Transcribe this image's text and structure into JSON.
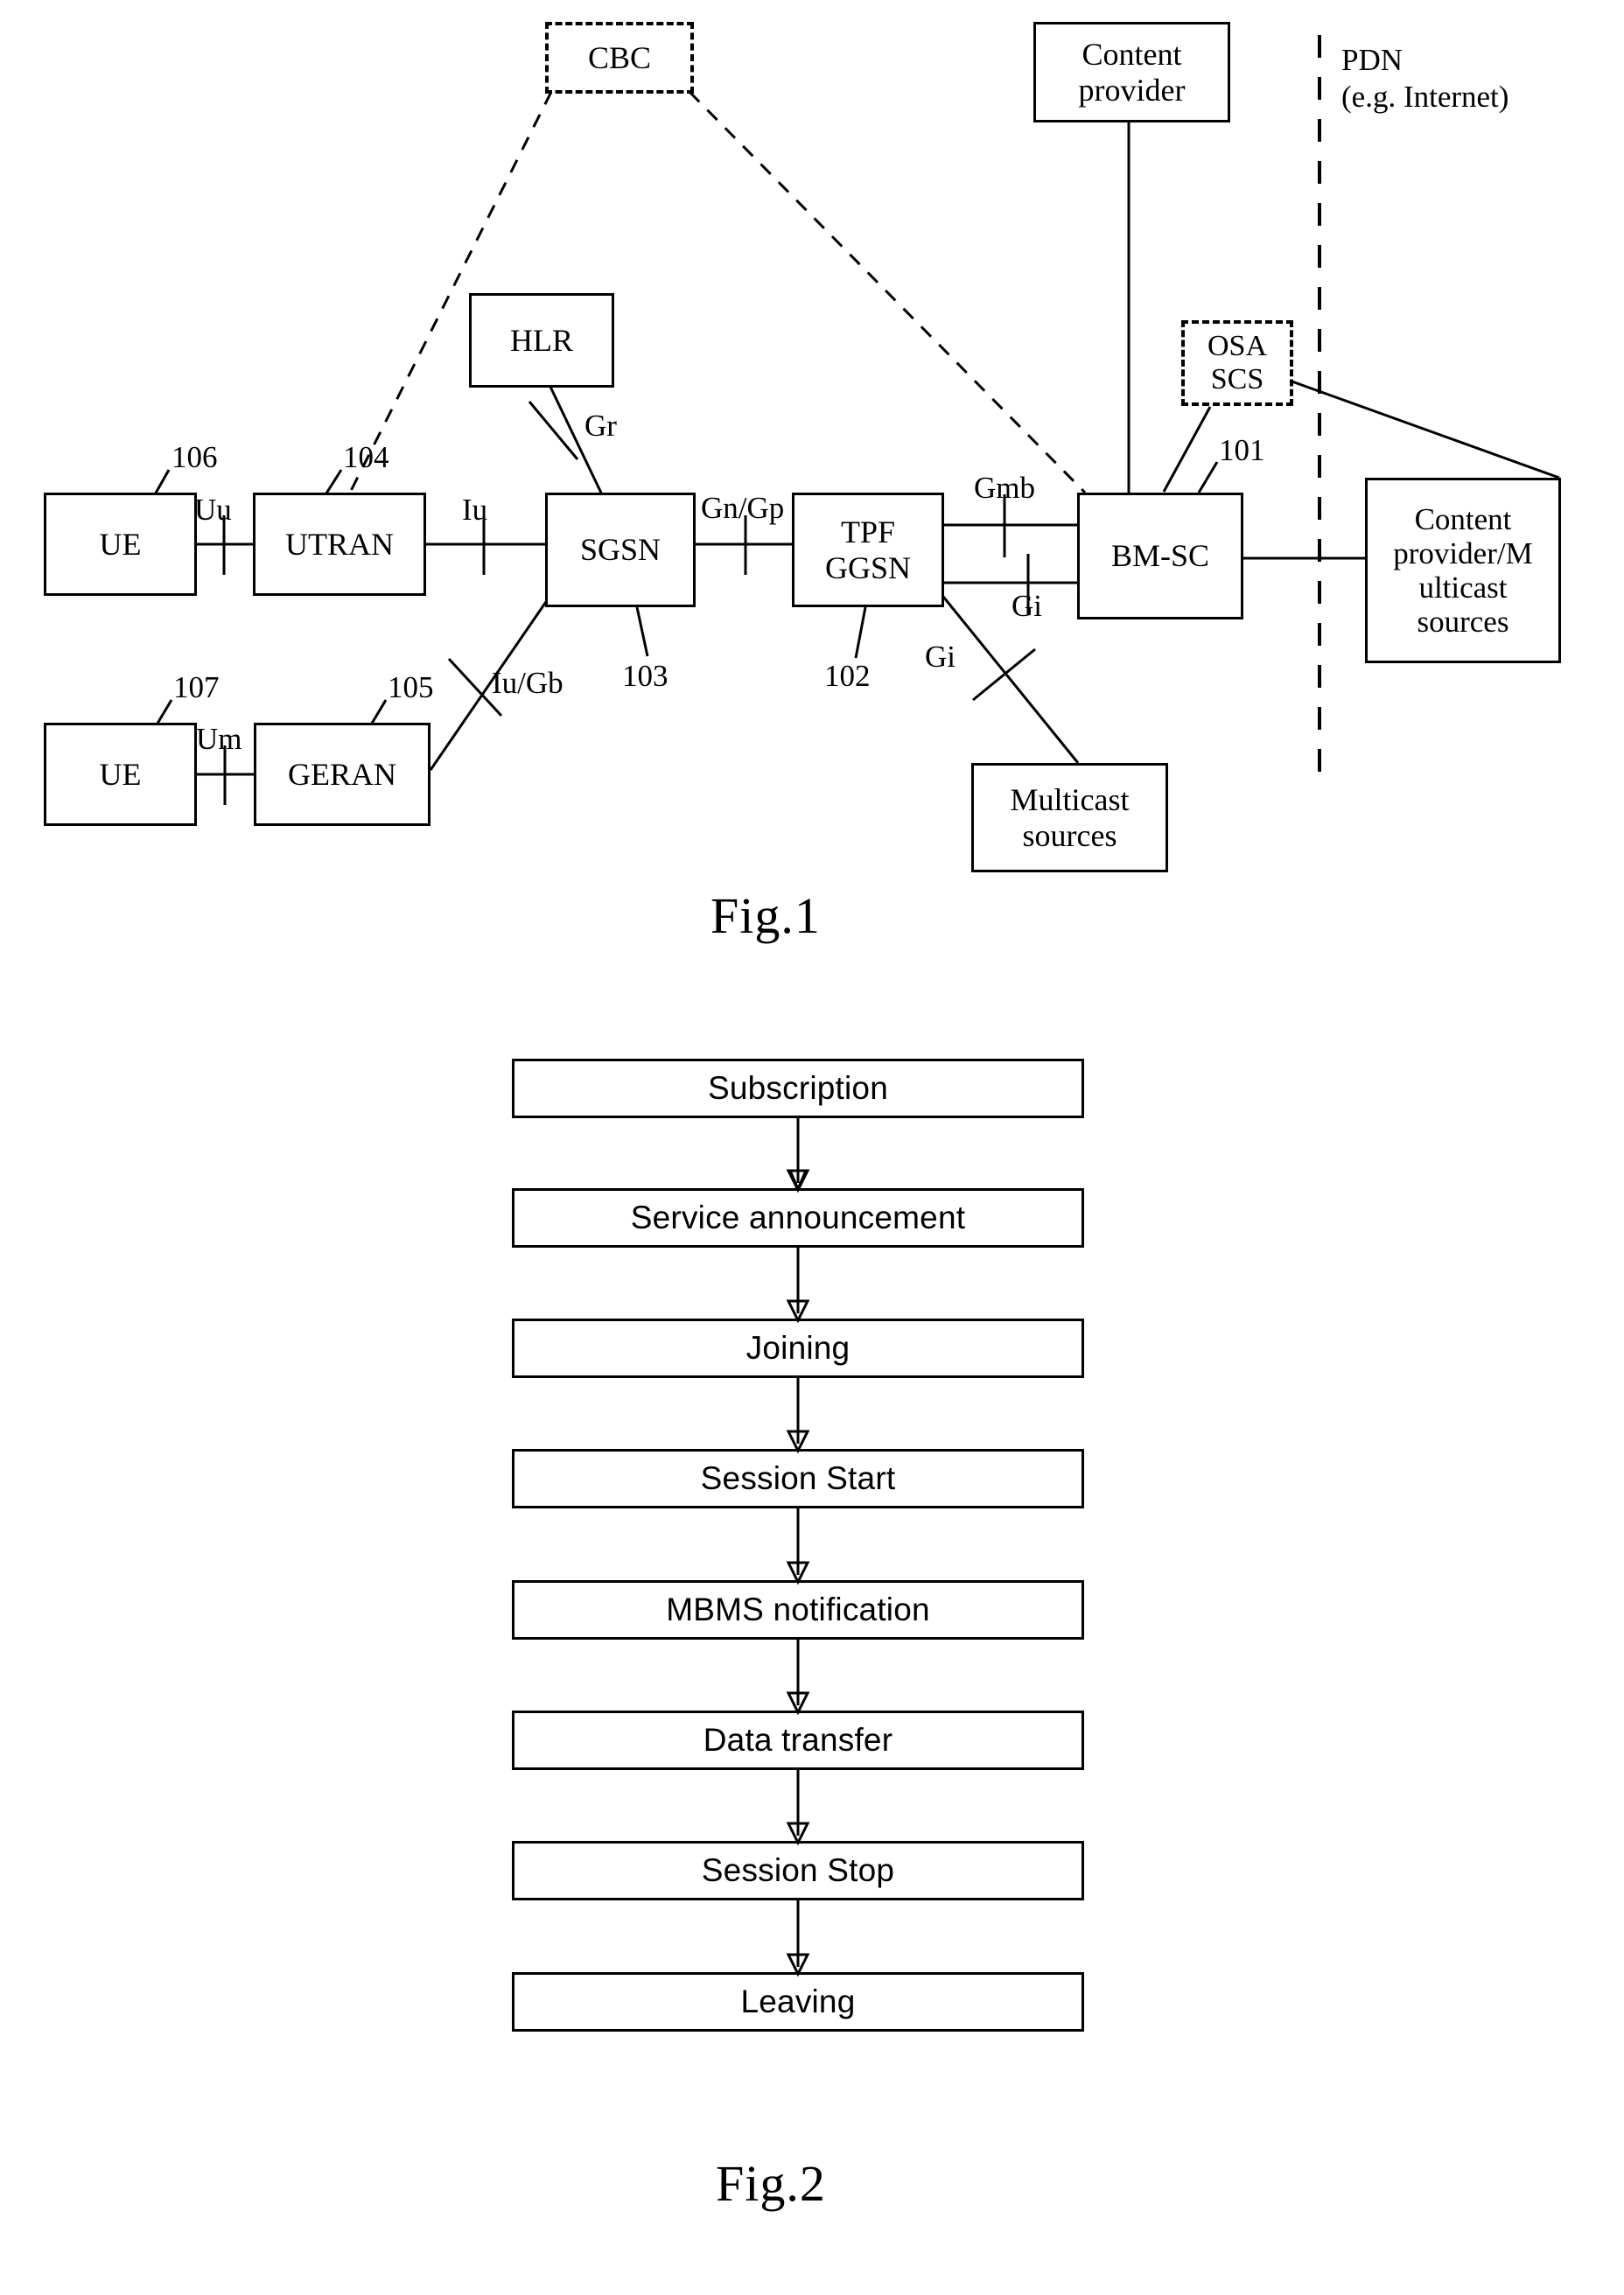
{
  "figure1": {
    "caption": "Fig.1",
    "nodes": {
      "cbc": "CBC",
      "content_provider": "Content\nprovider",
      "hlr": "HLR",
      "osa_scs": "OSA\nSCS",
      "ue_top": "UE",
      "utran": "UTRAN",
      "sgsn": "SGSN",
      "tpf_ggsn": "TPF\nGGSN",
      "bmsc": "BM-SC",
      "content_multicast": "Content\nprovider/M\nulticast\nsources",
      "ue_bottom": "UE",
      "geran": "GERAN",
      "multicast_sources": "Multicast\nsources"
    },
    "pdn_label": "PDN\n(e.g. Internet)",
    "interface_labels": {
      "uu": "Uu",
      "iu": "Iu",
      "gr": "Gr",
      "gn_gp": "Gn/Gp",
      "gmb": "Gmb",
      "gi_upper": "Gi",
      "gi_lower": "Gi",
      "um": "Um",
      "iu_gb": "Iu/Gb"
    },
    "reference_numerals": {
      "n101": "101",
      "n102": "102",
      "n103": "103",
      "n104": "104",
      "n105": "105",
      "n106": "106",
      "n107": "107"
    }
  },
  "figure2": {
    "caption": "Fig.2",
    "steps": [
      "Subscription",
      "Service announcement",
      "Joining",
      "Session Start",
      "MBMS notification",
      "Data transfer",
      "Session Stop",
      "Leaving"
    ]
  },
  "colors": {
    "ink": "#000000",
    "paper": "#ffffff"
  }
}
